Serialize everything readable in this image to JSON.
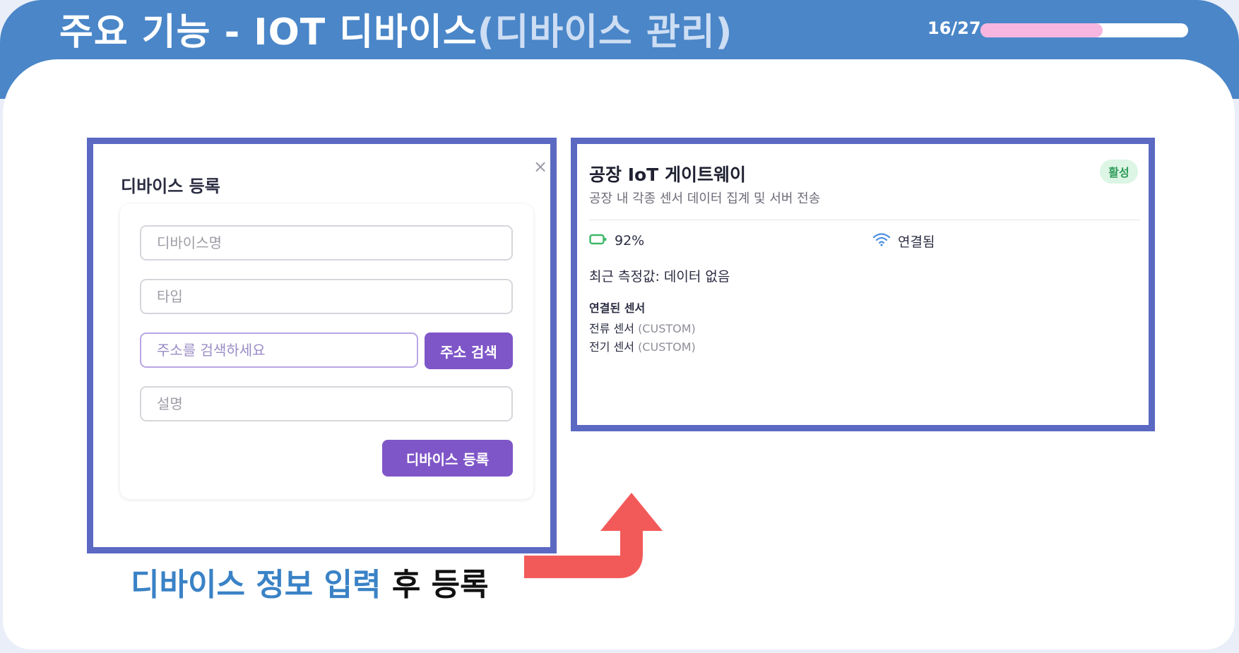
{
  "slide": {
    "title_main": "주요 기능 - IOT 디바이스",
    "title_sub": "(디바이스 관리)",
    "page": "16/27",
    "progress_fraction": 0.59
  },
  "register_modal": {
    "title": "디바이스 등록",
    "close_glyph": "×",
    "fields": {
      "name_placeholder": "디바이스명",
      "type_placeholder": "타입",
      "address_placeholder": "주소를 검색하세요",
      "description_placeholder": "설명"
    },
    "address_search_button": "주소 검색",
    "submit_button": "디바이스 등록"
  },
  "device_card": {
    "name": "공장 IoT 게이트웨이",
    "description": "공장 내 각종 센서 데이터 집계 및 서버 전송",
    "status_badge": "활성",
    "battery": "92%",
    "connection": "연결됨",
    "recent_value": "최근 측정값: 데이터 없음",
    "sensors_title": "연결된 센서",
    "sensors": [
      {
        "name": "전류 센서",
        "type": "(CUSTOM)"
      },
      {
        "name": "전기 센서",
        "type": "(CUSTOM)"
      }
    ]
  },
  "caption": {
    "highlight": "디바이스 정보 입력",
    "rest": "후 등록"
  },
  "colors": {
    "header": "#4a86c8",
    "frame": "#5b69c3",
    "button": "#7f56c8",
    "arrow": "#f25a59",
    "progress": "#f7b6df",
    "badge_bg": "#dcf5e4",
    "battery": "#3fb86b",
    "wifi": "#4a90e2"
  },
  "icons": {
    "battery": "battery-icon",
    "wifi": "wifi-icon",
    "arrow": "arrow-up-right-icon"
  }
}
